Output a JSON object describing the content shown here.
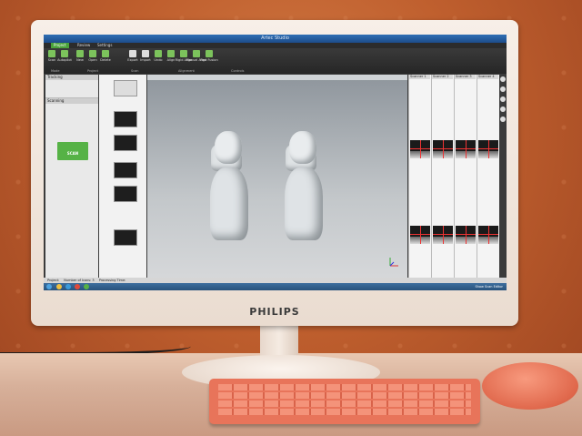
{
  "app": {
    "window_title": "Artec Studio",
    "tabs": [
      "Project",
      "Review",
      "Settings"
    ],
    "ribbon_buttons": [
      "Scan",
      "Autopilot",
      "New",
      "Open",
      "Delete",
      "Export",
      "Import",
      "Undo",
      "Align",
      "Rigid Align",
      "Manual Align",
      "Fast Fusion"
    ],
    "ribbon_groups": [
      "Mode",
      "Project",
      "Scan",
      "Alignment",
      "Controls"
    ],
    "left_panel": {
      "sections": [
        "Tracking",
        "Scanning"
      ],
      "scan_button": "SCAN"
    },
    "right_panel": {
      "columns": [
        "Scanner 1",
        "Scanner 2",
        "Scanner 3",
        "Scanner 4"
      ]
    },
    "statusbar": {
      "project": "Project:",
      "icons": "Number of Icons: 3",
      "processing": "Processing Time:"
    },
    "tray": "Show Scan Editor"
  },
  "monitor": {
    "brand": "PHILIPS"
  }
}
